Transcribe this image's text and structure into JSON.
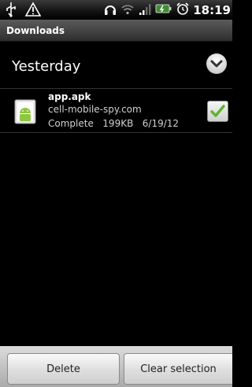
{
  "status_bar": {
    "time": "18:19",
    "icons": [
      "usb-icon",
      "warning-icon",
      "headset-icon",
      "wifi-icon",
      "signal-icon",
      "battery-icon",
      "alarm-icon"
    ]
  },
  "titlebar": {
    "title": "Downloads"
  },
  "group": {
    "label": "Yesterday",
    "icon": "chevron-down-icon"
  },
  "items": [
    {
      "name": "app.apk",
      "source": "cell-mobile-spy.com",
      "status": "Complete",
      "size": "199KB",
      "date": "6/19/12",
      "checked": true
    }
  ],
  "actions": {
    "delete_label": "Delete",
    "clear_label": "Clear selection"
  },
  "colors": {
    "check_green": "#5fb531",
    "android_green": "#8ec63f"
  }
}
